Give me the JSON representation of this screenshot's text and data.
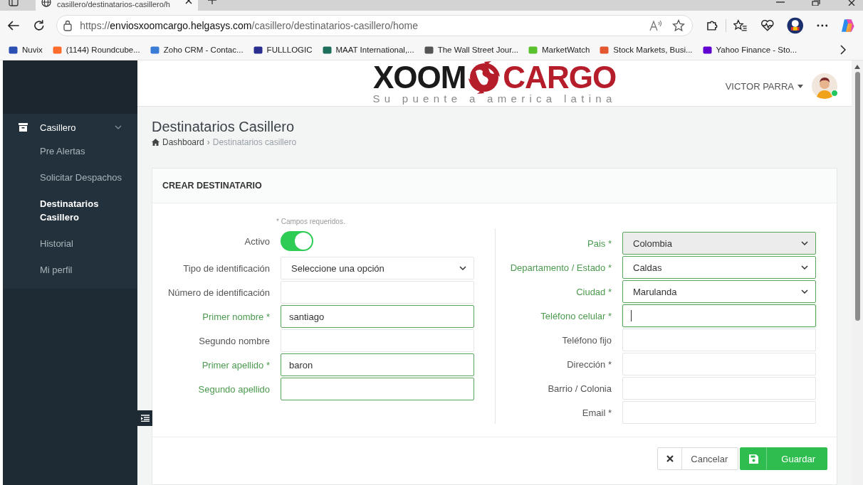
{
  "browser": {
    "tab_title": "casillero/destinatarios-casillero/h",
    "url": {
      "scheme": "https://",
      "host": "enviosxoomcargo.helgasys.com",
      "path": "/casillero/destinatarios-casillero/home"
    },
    "bookmarks": [
      {
        "label": "Nuvix"
      },
      {
        "label": "(1144) Roundcube..."
      },
      {
        "label": "Zoho CRM - Contac..."
      },
      {
        "label": "FULLLOGIC"
      },
      {
        "label": "MAAT International,..."
      },
      {
        "label": "The Wall Street Jour..."
      },
      {
        "label": "MarketWatch"
      },
      {
        "label": "Stock Markets, Busi..."
      },
      {
        "label": "Yahoo Finance - Sto..."
      }
    ]
  },
  "sidebar": {
    "items": [
      {
        "label": "Casillero",
        "expanded": true,
        "children": [
          {
            "label": "Pre Alertas",
            "selected": false
          },
          {
            "label": "Solicitar Despachos",
            "selected": false
          },
          {
            "label": "Destinatarios Casillero",
            "selected": true
          },
          {
            "label": "Historial",
            "selected": false
          },
          {
            "label": "Mi perfil",
            "selected": false
          }
        ]
      }
    ]
  },
  "header": {
    "logo": {
      "left": "XOOM",
      "right": "CARGO",
      "tagline": "Su puente a america latina"
    },
    "user": {
      "name": "VICTOR PARRA",
      "online": true
    }
  },
  "page": {
    "title": "Destinatarios Casillero",
    "separator": "›",
    "breadcrumb": [
      {
        "label": "Dashboard"
      },
      {
        "label": "Destinatarios casillero"
      }
    ]
  },
  "card": {
    "title": "CREAR DESTINATARIO",
    "note": "* Campos requeridos.",
    "left": [
      {
        "kind": "toggle",
        "label": "Activo",
        "on": true
      },
      {
        "kind": "select",
        "label": "Tipo de identificación",
        "value": "Seleccione una opción",
        "valid": false,
        "disabled": false,
        "focused": false
      },
      {
        "kind": "input",
        "label": "Número de identificación",
        "valid": false,
        "focused": false
      },
      {
        "kind": "input",
        "label": "Primer nombre *",
        "value": "santiago",
        "valid": true,
        "focused": false
      },
      {
        "kind": "input",
        "label": "Segundo nombre",
        "valid": false,
        "focused": false
      },
      {
        "kind": "input",
        "label": "Primer apellido *",
        "value": "baron",
        "valid": true,
        "focused": false
      },
      {
        "kind": "input",
        "label": "Segundo apellido",
        "valid": true,
        "focused": false
      }
    ],
    "right": [
      {
        "kind": "select",
        "label": "Pais *",
        "value": "Colombia",
        "valid": true,
        "disabled": true,
        "focused": false
      },
      {
        "kind": "select",
        "label": "Departamento / Estado *",
        "value": "Caldas",
        "valid": true,
        "disabled": false,
        "focused": false
      },
      {
        "kind": "select",
        "label": "Ciudad *",
        "value": "Marulanda",
        "valid": true,
        "disabled": false,
        "focused": false
      },
      {
        "kind": "input",
        "label": "Teléfono celular *",
        "valid": true,
        "focused": true
      },
      {
        "kind": "input",
        "label": "Teléfono fijo",
        "valid": false,
        "focused": false
      },
      {
        "kind": "input",
        "label": "Dirección *",
        "valid": false,
        "focused": false
      },
      {
        "kind": "input",
        "label": "Barrio / Colonia",
        "valid": false,
        "focused": false
      },
      {
        "kind": "input",
        "label": "Email *",
        "valid": false,
        "focused": false
      }
    ],
    "buttons": [
      {
        "kind": "cancel",
        "label": "Cancelar"
      },
      {
        "kind": "save",
        "label": "Guardar"
      }
    ]
  }
}
